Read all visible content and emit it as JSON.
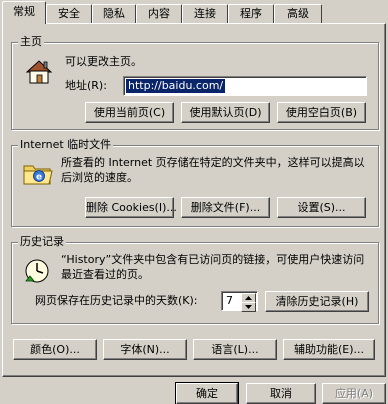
{
  "tabs": [
    {
      "label": "常规"
    },
    {
      "label": "安全"
    },
    {
      "label": "隐私"
    },
    {
      "label": "内容"
    },
    {
      "label": "连接"
    },
    {
      "label": "程序"
    },
    {
      "label": "高级"
    }
  ],
  "homepage": {
    "title": "主页",
    "description": "可以更改主页。",
    "address_label": "地址(R):",
    "address_value": "http://baidu.com/",
    "btn_current": "使用当前页(C)",
    "btn_default": "使用默认页(D)",
    "btn_blank": "使用空白页(B)",
    "icon": "house-icon"
  },
  "temp_files": {
    "title": "Internet 临时文件",
    "description": "所查看的 Internet 页存储在特定的文件夹中，这样可以提高以后浏览的速度。",
    "btn_delete_cookies": "删除 Cookies(I)...",
    "btn_delete_files": "删除文件(F)...",
    "btn_settings": "设置(S)...",
    "icon": "ie-folder-icon"
  },
  "history": {
    "title": "历史记录",
    "description": "“History”文件夹中包含有已访问页的链接，可使用户快速访问最近查看过的页。",
    "days_label": "网页保存在历史记录中的天数(K):",
    "days_value": "7",
    "btn_clear": "清除历史记录(H)",
    "icon": "history-clock-icon"
  },
  "bottom_buttons": {
    "colors": "颜色(O)...",
    "fonts": "字体(N)...",
    "languages": "语言(L)...",
    "accessibility": "辅助功能(E)..."
  },
  "dialog_buttons": {
    "ok": "确定",
    "cancel": "取消",
    "apply": "应用(A)"
  }
}
